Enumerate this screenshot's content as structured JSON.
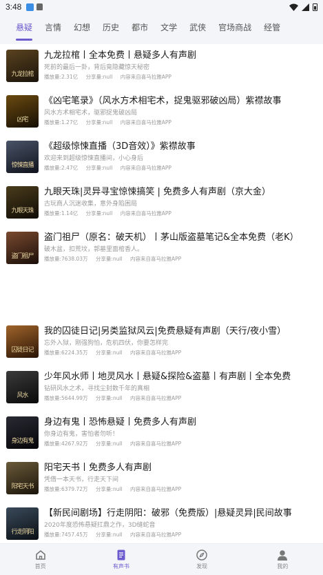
{
  "status_bar": {
    "time": "3:48"
  },
  "tabs": [
    {
      "label": "悬疑",
      "active": true
    },
    {
      "label": "言情",
      "active": false
    },
    {
      "label": "幻想",
      "active": false
    },
    {
      "label": "历史",
      "active": false
    },
    {
      "label": "都市",
      "active": false
    },
    {
      "label": "文学",
      "active": false
    },
    {
      "label": "武侠",
      "active": false
    },
    {
      "label": "官场商战",
      "active": false
    },
    {
      "label": "经管",
      "active": false
    }
  ],
  "items": [
    {
      "title": "九龙拉棺丨全本免费丨悬疑多人有声剧",
      "desc": "死前的最后一卦，背后竟隐藏惊天秘密",
      "plays": "播放量:2.31亿",
      "share": "分享量:null",
      "source": "内容来自喜马拉雅APP",
      "cover_color": "#2a2116",
      "cover_text": "九龙拉棺"
    },
    {
      "title": "《凶宅笔录》（风水方术相宅术，捉鬼驱邪破凶局）紫襟故事",
      "desc": "风水方术相宅术，驱邪捉鬼破凶局",
      "plays": "播放量:1.27亿",
      "share": "分享量:null",
      "source": "内容来自喜马拉雅APP",
      "cover_color": "#2b2208",
      "cover_text": "凶宅"
    },
    {
      "title": "《超级惊悚直播（3D音效）》紫襟故事",
      "desc": "欢迎来到超级惊悚直播间，小心身后",
      "plays": "播放量:2.47亿",
      "share": "分享量:null",
      "source": "内容来自喜马拉雅APP",
      "cover_color": "#1c2130",
      "cover_text": "惊悚直播"
    },
    {
      "title": "九眼天珠|灵异寻宝惊悚搞笑 | 免费多人有声剧（京大金）",
      "desc": "古玩商人沉迷收集，意外身陷困局",
      "plays": "播放量:1.14亿",
      "share": "分享量:null",
      "source": "内容来自喜马拉雅APP",
      "cover_color": "#1e1a10",
      "cover_text": "九眼天珠"
    },
    {
      "title": "盗门祖尸（原名：破天机）丨茅山版盗墓笔记&全本免费（老K）",
      "desc": "破木盆，扣荒坟，郭墓里面棺香人。",
      "plays": "播放量:7638.03万",
      "share": "分享量:null",
      "source": "内容来自喜马拉雅APP",
      "cover_color": "#3a2418",
      "cover_text": "盗门祖尸"
    },
    {
      "title": "我的囚徒日记|另类监狱风云|免费悬疑有声剧（天行/夜小雪）",
      "desc": "忘外入狱，刚强狗怕，危机四伏，你要怎样完",
      "plays": "播放量:6224.35万",
      "share": "分享量:null",
      "source": "内容来自喜马拉雅APP",
      "cover_color": "#4a2a10",
      "cover_text": "囚徒日记"
    },
    {
      "title": "少年风水师丨地灵风水丨悬疑&探险&盗墓丨有声剧丨全本免费",
      "desc": "钻研风水之术，寻找尘封数千年的真相",
      "plays": "播放量:5644.99万",
      "share": "分享量:null",
      "source": "内容来自喜马拉雅APP",
      "cover_color": "#1a1a1a",
      "cover_text": "风水"
    },
    {
      "title": "身边有鬼丨恐怖悬疑丨免费多人有声剧",
      "desc": "你身边有鬼，害怕者勿听！",
      "plays": "播放量:4267.92万",
      "share": "分享量:null",
      "source": "内容来自喜马拉雅APP",
      "cover_color": "#0c0c10",
      "cover_text": "身边有鬼"
    },
    {
      "title": "阳宅天书丨免费多人有声剧",
      "desc": "凭借一本天书，行走天下间",
      "plays": "播放量:6379.72万",
      "share": "分享量:null",
      "source": "内容来自喜马拉雅APP",
      "cover_color": "#3a3020",
      "cover_text": "阳宅天书"
    },
    {
      "title": "【新民间剧场】行走阴阳：破邪（免费版）|悬疑灵异|民间故事",
      "desc": "2020年度恐怖悬疑扛鼎之作，3D缝蛇音",
      "plays": "播放量:7457.45万",
      "share": "分享量:null",
      "source": "内容来自喜马拉雅APP",
      "cover_color": "#1c2430",
      "cover_text": "行走阴阳"
    }
  ],
  "bottom_nav": [
    {
      "label": "首页",
      "icon": "home-icon",
      "active": false
    },
    {
      "label": "有声书",
      "icon": "book-icon",
      "active": true
    },
    {
      "label": "发现",
      "icon": "compass-icon",
      "active": false
    },
    {
      "label": "我的",
      "icon": "person-icon",
      "active": false
    }
  ],
  "colors": {
    "accent": "#6a5ccf",
    "background": "#f4f5f8"
  }
}
